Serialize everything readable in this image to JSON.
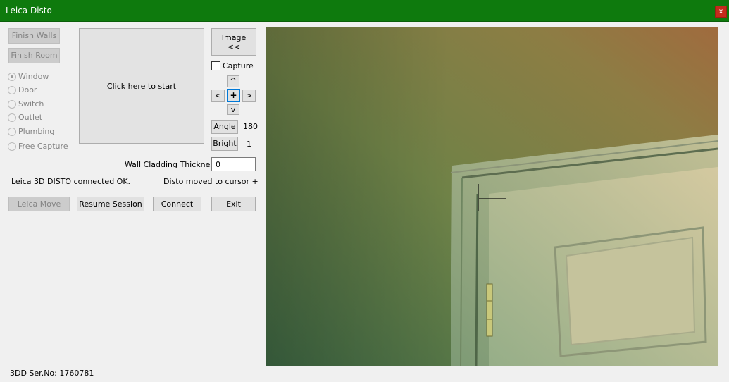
{
  "window": {
    "title": "Leica Disto",
    "close_label": "x"
  },
  "left_buttons": {
    "finish_walls": "Finish Walls",
    "finish_room": "Finish Room"
  },
  "radio_options": [
    "Window",
    "Door",
    "Switch",
    "Outlet",
    "Plumbing",
    "Free Capture"
  ],
  "selected_option": "Window",
  "start_area": {
    "label": "Click here to start"
  },
  "image_button": {
    "line1": "Image",
    "line2": "<<"
  },
  "capture": {
    "label": "Capture",
    "checked": false
  },
  "dpad": {
    "up": "^",
    "left": "<",
    "center": "+",
    "right": ">",
    "down": "v"
  },
  "angle": {
    "label": "Angle",
    "value": "180"
  },
  "bright": {
    "label": "Bright",
    "value": "1"
  },
  "wall_cladding": {
    "label": "Wall Cladding Thickness",
    "value": "0"
  },
  "status": {
    "connection": "Leica 3D DISTO connected OK.",
    "disto": "Disto moved to cursor +"
  },
  "action_buttons": {
    "leica_move": "Leica Move",
    "resume_session": "Resume Session",
    "connect": "Connect",
    "exit": "Exit"
  },
  "footer": {
    "serial": "3DD Ser.No: 1760781"
  },
  "colors": {
    "title_bar": "#0e7a0d",
    "close": "#c42b1c",
    "focus": "#0078d7"
  }
}
